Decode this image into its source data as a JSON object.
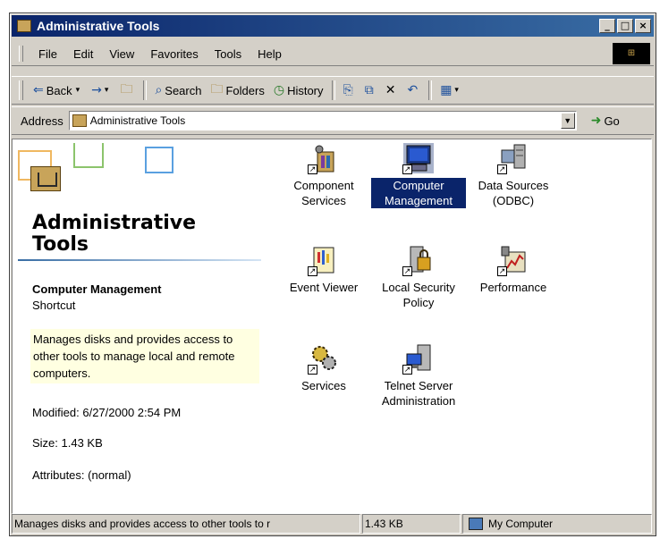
{
  "window": {
    "title": "Administrative Tools",
    "controls": [
      "_",
      "□",
      "×"
    ],
    "logo": "⊞"
  },
  "menu": [
    "File",
    "Edit",
    "View",
    "Favorites",
    "Tools",
    "Help"
  ],
  "toolbar": {
    "back": "Back",
    "forward_icon": "→",
    "up_icon": "up-folder",
    "search": "Search",
    "folders": "Folders",
    "history": "History",
    "views_icon": "views"
  },
  "address": {
    "label": "Address",
    "value": "Administrative Tools",
    "go": "Go"
  },
  "left_pane": {
    "title": "Administrative Tools",
    "selected_name": "Computer Management",
    "selected_type": "Shortcut",
    "description": "Manages disks and provides access to other tools to manage local and remote computers.",
    "modified": "Modified: 6/27/2000 2:54 PM",
    "size": "Size: 1.43 KB",
    "attributes": "Attributes: (normal)"
  },
  "icons": [
    {
      "label": "Component Services",
      "icon": "component-services-icon",
      "selected": false
    },
    {
      "label": "Computer Management",
      "icon": "computer-management-icon",
      "selected": true
    },
    {
      "label": "Data Sources (ODBC)",
      "icon": "data-sources-icon",
      "selected": false
    },
    {
      "label": "Event Viewer",
      "icon": "event-viewer-icon",
      "selected": false
    },
    {
      "label": "Local Security Policy",
      "icon": "local-security-policy-icon",
      "selected": false
    },
    {
      "label": "Performance",
      "icon": "performance-icon",
      "selected": false
    },
    {
      "label": "Services",
      "icon": "services-icon",
      "selected": false
    },
    {
      "label": "Telnet Server Administration",
      "icon": "telnet-server-icon",
      "selected": false
    }
  ],
  "status": {
    "message": "Manages disks and provides access to other tools to r",
    "size": "1.43 KB",
    "zone": "My Computer"
  },
  "colors": {
    "title_bar": "#0a246a",
    "selection": "#0a246a",
    "tooltip_bg": "#ffffe1",
    "chrome": "#d4d0c8"
  }
}
